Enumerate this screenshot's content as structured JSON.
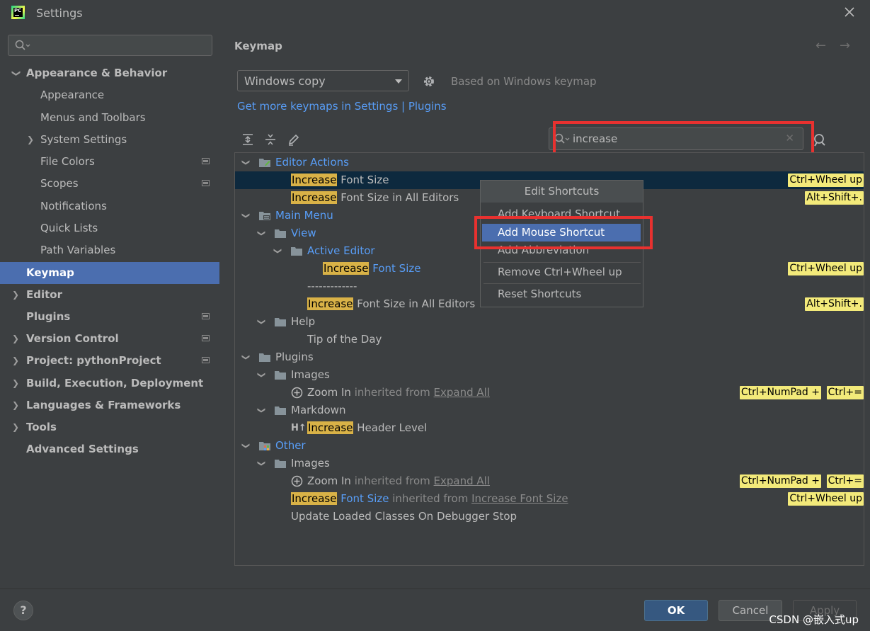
{
  "window": {
    "title": "Settings"
  },
  "sidebar": {
    "search_value": "",
    "items": [
      {
        "label": "Appearance & Behavior",
        "level": 0,
        "bold": true,
        "chevron": "down"
      },
      {
        "label": "Appearance",
        "level": 1
      },
      {
        "label": "Menus and Toolbars",
        "level": 1
      },
      {
        "label": "System Settings",
        "level": 1,
        "chevron": "right"
      },
      {
        "label": "File Colors",
        "level": 1,
        "project": true
      },
      {
        "label": "Scopes",
        "level": 1,
        "project": true
      },
      {
        "label": "Notifications",
        "level": 1
      },
      {
        "label": "Quick Lists",
        "level": 1
      },
      {
        "label": "Path Variables",
        "level": 1
      },
      {
        "label": "Keymap",
        "level": 0,
        "bold": true,
        "selected": true
      },
      {
        "label": "Editor",
        "level": 0,
        "bold": true,
        "chevron": "right"
      },
      {
        "label": "Plugins",
        "level": 0,
        "bold": true,
        "project": true
      },
      {
        "label": "Version Control",
        "level": 0,
        "bold": true,
        "chevron": "right",
        "project": true
      },
      {
        "label": "Project: pythonProject",
        "level": 0,
        "bold": true,
        "chevron": "right",
        "project": true
      },
      {
        "label": "Build, Execution, Deployment",
        "level": 0,
        "bold": true,
        "chevron": "right"
      },
      {
        "label": "Languages & Frameworks",
        "level": 0,
        "bold": true,
        "chevron": "right"
      },
      {
        "label": "Tools",
        "level": 0,
        "bold": true,
        "chevron": "right"
      },
      {
        "label": "Advanced Settings",
        "level": 0,
        "bold": true
      }
    ]
  },
  "main": {
    "title": "Keymap",
    "keymap_select": "Windows copy",
    "based_on": "Based on Windows keymap",
    "more_link": "Get more keymaps in Settings | Plugins",
    "filter_value": "increase"
  },
  "tree": {
    "r1": {
      "label": "Editor Actions"
    },
    "r2": {
      "hl": "Increase",
      "rest": " Font Size",
      "shortcut": "Ctrl+Wheel up"
    },
    "r3": {
      "hl": "Increase",
      "rest": " Font Size in All Editors",
      "shortcut": "Alt+Shift+."
    },
    "r4": {
      "label": "Main Menu"
    },
    "r5": {
      "label": "View"
    },
    "r6": {
      "label": "Active Editor"
    },
    "r7": {
      "hl": "Increase",
      "rest": " Font Size",
      "shortcut": "Ctrl+Wheel up"
    },
    "r8": {
      "label": "-------------"
    },
    "r9": {
      "hl": "Increase",
      "rest": " Font Size in All Editors",
      "shortcut": "Alt+Shift+."
    },
    "r10": {
      "label": "Help"
    },
    "r11": {
      "label": "Tip of the Day"
    },
    "r12": {
      "label": "Plugins"
    },
    "r13": {
      "label": "Images"
    },
    "r14": {
      "label": "Zoom In",
      "inherited": " inherited from ",
      "link": "Expand All",
      "shortcut1": "Ctrl+NumPad +",
      "shortcut2": "Ctrl+="
    },
    "r15": {
      "label": "Markdown"
    },
    "r16": {
      "hl": "Increase",
      "rest": " Header Level"
    },
    "r17": {
      "label": "Other"
    },
    "r18": {
      "label": "Images"
    },
    "r19": {
      "label": "Zoom In",
      "inherited": " inherited from ",
      "link": "Expand All",
      "shortcut1": "Ctrl+NumPad +",
      "shortcut2": "Ctrl+="
    },
    "r20": {
      "hl": "Increase",
      "rest": " Font Size",
      "inherited": " inherited from ",
      "link": "Increase Font Size",
      "shortcut": "Ctrl+Wheel up"
    },
    "r21": {
      "label": "Update Loaded Classes On Debugger Stop"
    }
  },
  "popup": {
    "title": "Edit Shortcuts",
    "add_keyboard": "Add Keyboard Shortcut",
    "add_mouse": "Add Mouse Shortcut",
    "add_abbrev": "Add Abbreviation",
    "remove": "Remove Ctrl+Wheel up",
    "reset": "Reset Shortcuts"
  },
  "footer": {
    "help": "?",
    "ok": "OK",
    "cancel": "Cancel",
    "apply": "Apply",
    "watermark": "CSDN @嵌入式up"
  },
  "colors": {
    "accent": "#4b6eaf",
    "link": "#589df6",
    "highlight": "#d9b247",
    "shortcut_bg": "#f3ea7a",
    "annotation_red": "#e8312f"
  }
}
